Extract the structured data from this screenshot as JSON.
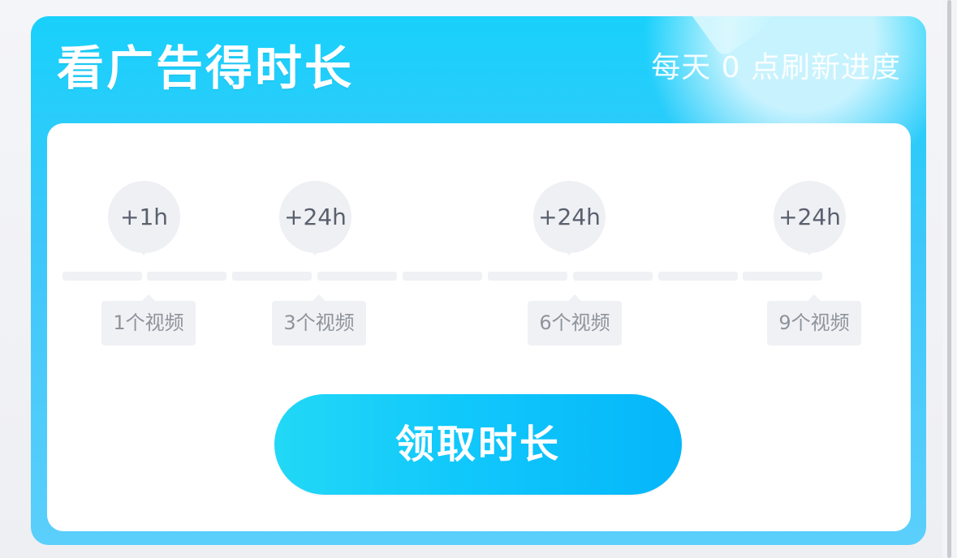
{
  "card": {
    "title": "看广告得时长",
    "subtitle": "每天 0 点刷新进度"
  },
  "rewards": [
    {
      "reward": "+1h",
      "videos": "1个视频"
    },
    {
      "reward": "+24h",
      "videos": "3个视频"
    },
    {
      "reward": "+24h",
      "videos": "6个视频"
    },
    {
      "reward": "+24h",
      "videos": "9个视频"
    }
  ],
  "progress": {
    "completed_videos": 0,
    "total_videos": 9,
    "segments": 9
  },
  "button": {
    "label": "领取时长"
  },
  "colors": {
    "card_gradient_top": "#18d1fb",
    "card_gradient_bottom": "#5bcffb",
    "button_start": "#22d8f6",
    "button_end": "#05b6fa",
    "inactive": "#f0f1f4"
  }
}
